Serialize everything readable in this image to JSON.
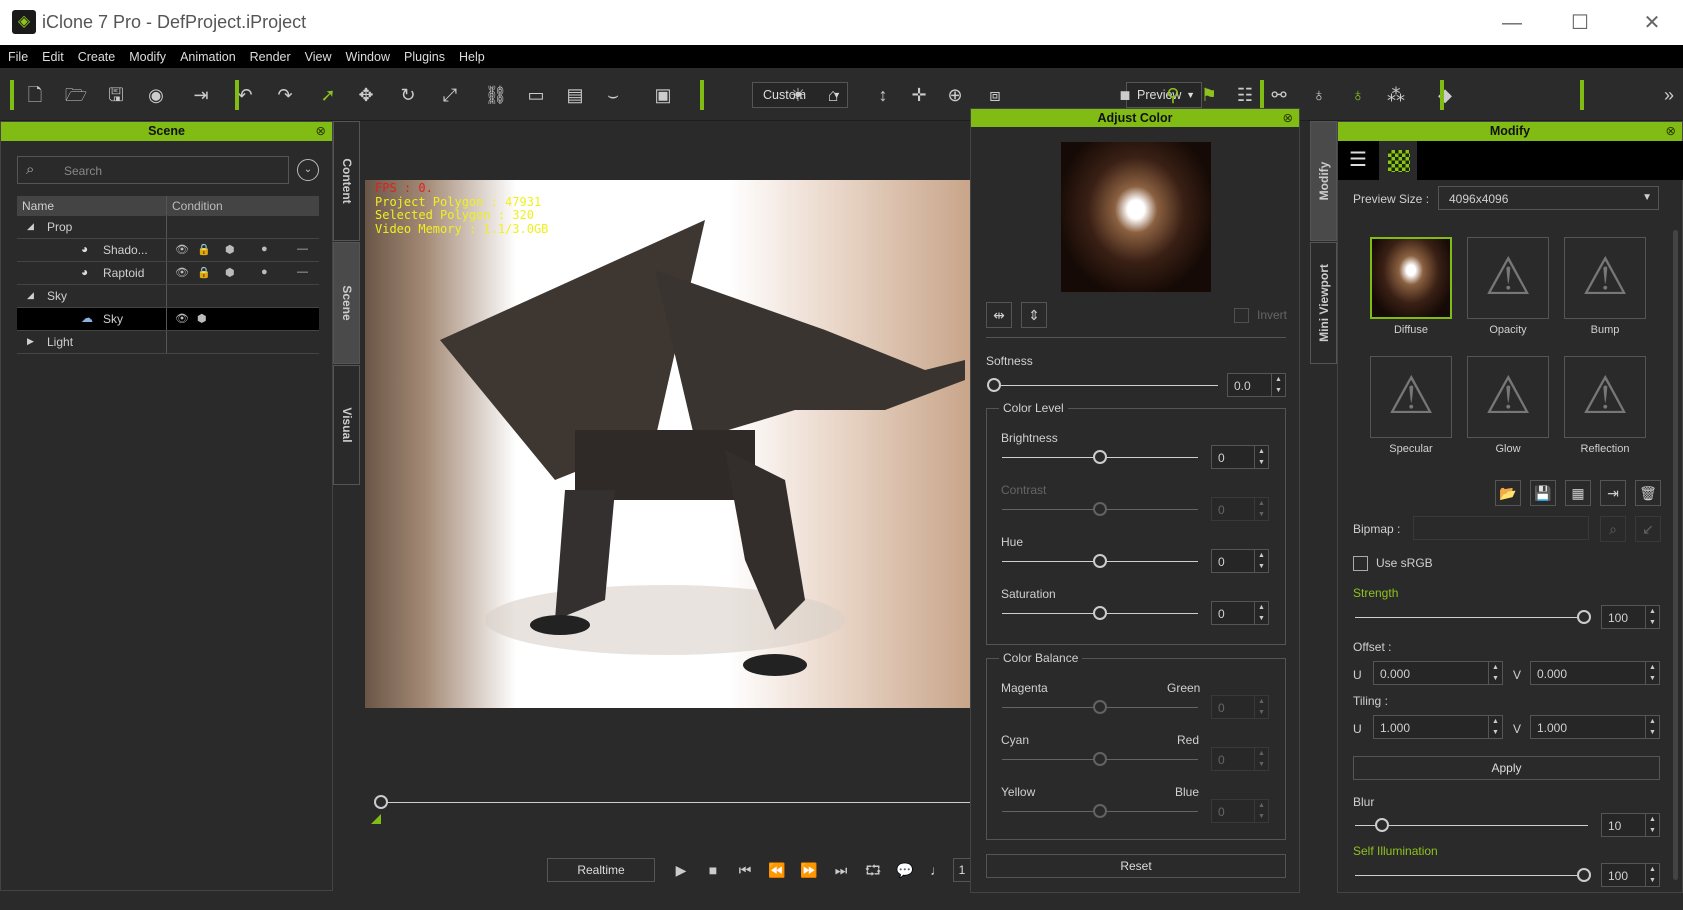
{
  "window": {
    "title": "iClone 7 Pro - DefProject.iProject",
    "minimize": "—",
    "maximize": "☐",
    "close": "✕"
  },
  "menu": [
    "File",
    "Edit",
    "Create",
    "Modify",
    "Animation",
    "Render",
    "View",
    "Window",
    "Plugins",
    "Help"
  ],
  "toolbar": {
    "custom_dropdown": "Custom",
    "preview_dropdown": "Preview",
    "more": "»",
    "icons": [
      "new-file",
      "open-folder",
      "save",
      "render-preview",
      "exit-to",
      "undo",
      "redo",
      "select-arrow",
      "move",
      "rotate",
      "scale",
      "link",
      "align-left",
      "align-distribute",
      "eye-lashes",
      "layout",
      "sun",
      "home",
      "fit-vertical",
      "fit-all",
      "camera-orbit",
      "box-view",
      "video-camera",
      "motion-puppet",
      "flag",
      "timeline-list",
      "node-link",
      "gizmo-a",
      "gizmo-b",
      "cube-stack",
      "keyframe"
    ]
  },
  "scene_panel": {
    "title": "Scene",
    "search_placeholder": "Search",
    "columns": [
      "Name",
      "Condition"
    ],
    "rows": [
      {
        "name": "Prop",
        "level": 0,
        "expanded": true
      },
      {
        "name": "Shado...",
        "level": 1
      },
      {
        "name": "Raptoid",
        "level": 1
      },
      {
        "name": "Sky",
        "level": 0,
        "expanded": true
      },
      {
        "name": "Sky",
        "level": 1,
        "selected": true
      },
      {
        "name": "Light",
        "level": 0,
        "expanded": false
      }
    ]
  },
  "left_tabs": [
    "Content",
    "Scene",
    "Visual"
  ],
  "viewport": {
    "fps": "FPS : 0.",
    "project_polygon": "Project Polygon : 47931",
    "selected_polygon": "Selected Polygon : 320",
    "video_memory": "Video Memory : 1.1/3.0GB"
  },
  "playback": {
    "realtime": "Realtime",
    "frame": "1"
  },
  "adjust_color": {
    "title": "Adjust Color",
    "invert": "Invert",
    "softness_label": "Softness",
    "softness": "0.0",
    "color_level": "Color Level",
    "brightness_label": "Brightness",
    "brightness": "0",
    "contrast_label": "Contrast",
    "contrast": "0",
    "hue_label": "Hue",
    "hue": "0",
    "saturation_label": "Saturation",
    "saturation": "0",
    "color_balance": "Color Balance",
    "magenta": "Magenta",
    "green": "Green",
    "mg": "0",
    "cyan": "Cyan",
    "red": "Red",
    "cr": "0",
    "yellow": "Yellow",
    "blue": "Blue",
    "yb": "0",
    "reset": "Reset"
  },
  "right_tabs": [
    "Modify",
    "Mini Viewport"
  ],
  "modify": {
    "title": "Modify",
    "preview_size_label": "Preview Size :",
    "preview_size": "4096x4096",
    "channels": [
      "Diffuse",
      "Opacity",
      "Bump",
      "Specular",
      "Glow",
      "Reflection"
    ],
    "bipmap_label": "Bipmap :",
    "use_srgb": "Use sRGB",
    "strength_label": "Strength",
    "strength": "100",
    "offset_label": "Offset :",
    "u": "U",
    "v": "V",
    "offset_u": "0.000",
    "offset_v": "0.000",
    "tiling_label": "Tiling :",
    "tiling_u": "1.000",
    "tiling_v": "1.000",
    "apply": "Apply",
    "blur_label": "Blur",
    "blur": "10",
    "self_illum_label": "Self Illumination",
    "self_illum": "100"
  },
  "colors": {
    "accent": "#80bc14",
    "fps": "#e02020",
    "hud": "#f0f020"
  }
}
